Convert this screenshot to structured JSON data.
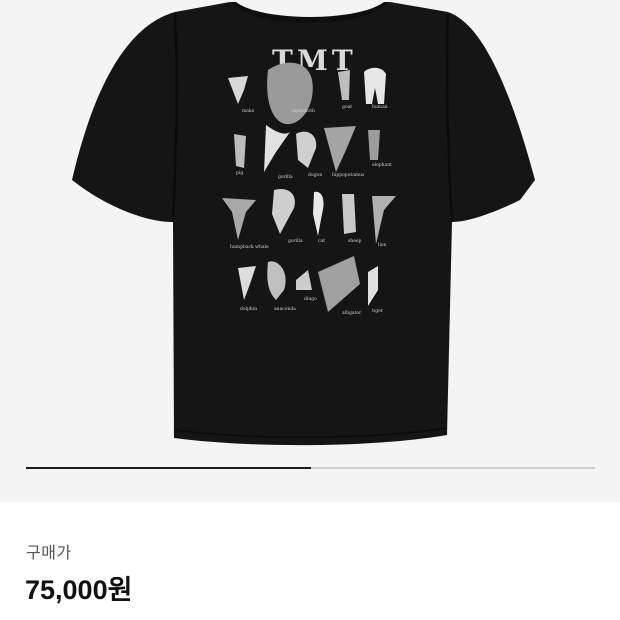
{
  "product": {
    "graphic_logo": "TMT",
    "tooth_captions": [
      "mako",
      "mammoth",
      "goat",
      "human",
      "pig",
      "gorilla",
      "dugon",
      "hippopotamus",
      "elephant",
      "humpback whale",
      "gorilla",
      "cat",
      "sheep",
      "lion",
      "dolphin",
      "anaconda",
      "dingo",
      "alligator",
      "tiger"
    ],
    "carousel_progress": 0.5
  },
  "price": {
    "label": "구매가",
    "value": "75,000원"
  },
  "colors": {
    "image_background": "#f4f4f4",
    "shirt": "#151515",
    "progress_track": "#cfcfcf",
    "progress_fill": "#1a1a1a"
  }
}
